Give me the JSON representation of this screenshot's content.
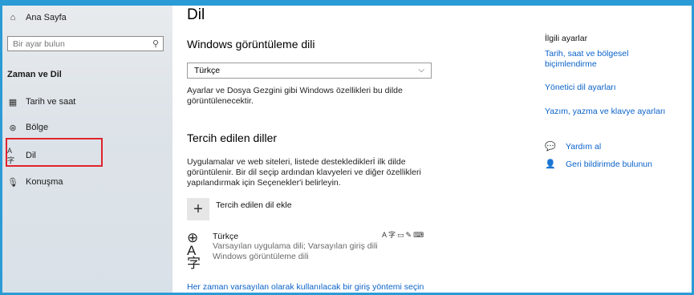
{
  "sidebar": {
    "home_label": "Ana Sayfa",
    "search_placeholder": "Bir ayar bulun",
    "section_title": "Zaman ve Dil",
    "items": [
      {
        "label": "Tarih ve saat"
      },
      {
        "label": "Bölge"
      },
      {
        "label": "Dil"
      },
      {
        "label": "Konuşma"
      }
    ]
  },
  "main": {
    "title": "Dil",
    "display_language": {
      "heading": "Windows görüntüleme dili",
      "selected": "Türkçe",
      "desc_line1": "Ayarlar ve Dosya Gezgini gibi Windows özellikleri bu dilde",
      "desc_line2": "görüntülenecektir."
    },
    "preferred": {
      "heading": "Tercih edilen diller",
      "desc_line1": "Uygulamalar ve web siteleri, listede desteklediklerİ ilk dilde",
      "desc_line2": "görüntülenir. Bir dil seçip ardından klavyeleri ve diğer özellikleri",
      "desc_line3": "yapılandırmak için Seçenekler'i belirleyin.",
      "add_label": "Tercih edilen dil ekle",
      "language": {
        "name": "Türkçe",
        "sub_line1": "Varsayılan uygulama dili; Varsayılan giriş dili",
        "sub_line2": "Windows görüntüleme dili"
      }
    },
    "bottom_link": "Her zaman varsayılan olarak kullanılacak bir giriş yöntemi seçin"
  },
  "related": {
    "title": "İlgili ayarlar",
    "link1_line1": "Tarih, saat ve bölgesel",
    "link1_line2": "biçimlendirme",
    "link2": "Yönetici dil ayarları",
    "link3": "Yazım, yazma ve klavye ayarları",
    "help": "Yardım al",
    "feedback": "Geri bildirimde bulunun"
  },
  "colors": {
    "accent": "#2b9bd6",
    "link": "#0a62c9",
    "highlight": "#e0242e"
  }
}
